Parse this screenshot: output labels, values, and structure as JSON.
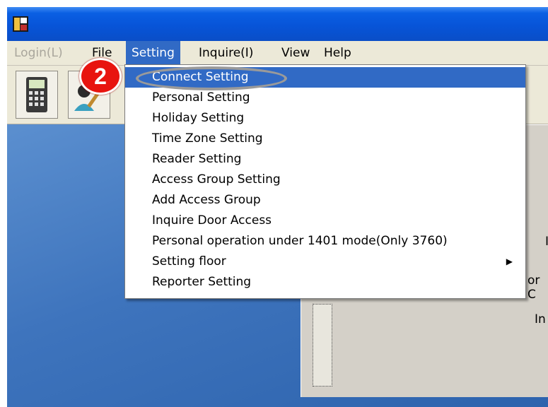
{
  "menubar": {
    "items": [
      {
        "label": "Login(L)",
        "state": "disabled"
      },
      {
        "label": "File",
        "state": "normal"
      },
      {
        "label": "Setting",
        "state": "active"
      },
      {
        "label": "Inquire(I)",
        "state": "normal"
      },
      {
        "label": "View",
        "state": "normal"
      },
      {
        "label": "Help",
        "state": "normal"
      }
    ]
  },
  "toolbar": {
    "buttons": [
      {
        "icon": "calculator-icon"
      },
      {
        "icon": "person-edit-icon"
      }
    ]
  },
  "setting_menu": {
    "items": [
      {
        "label": "Connect Setting",
        "highlighted": true
      },
      {
        "label": "Personal Setting"
      },
      {
        "label": "Holiday Setting"
      },
      {
        "label": "Time Zone Setting"
      },
      {
        "label": "Reader Setting"
      },
      {
        "label": "Access Group Setting"
      },
      {
        "label": "Add Access Group"
      },
      {
        "label": "Inquire Door Access"
      },
      {
        "label": "Personal operation under 1401 mode(Only 3760)"
      },
      {
        "label": "Setting floor",
        "has_submenu": true
      },
      {
        "label": "Reporter Setting"
      }
    ]
  },
  "annotation": {
    "step_number": "2",
    "badge_color": "#e8140f"
  },
  "background_panel": {
    "text_fragments": [
      "I",
      "or C",
      "In"
    ]
  },
  "colors": {
    "titlebar": "#0754d8",
    "highlight": "#316ac5",
    "menubar": "#ece9d8",
    "desktop": "#3e74bd"
  }
}
